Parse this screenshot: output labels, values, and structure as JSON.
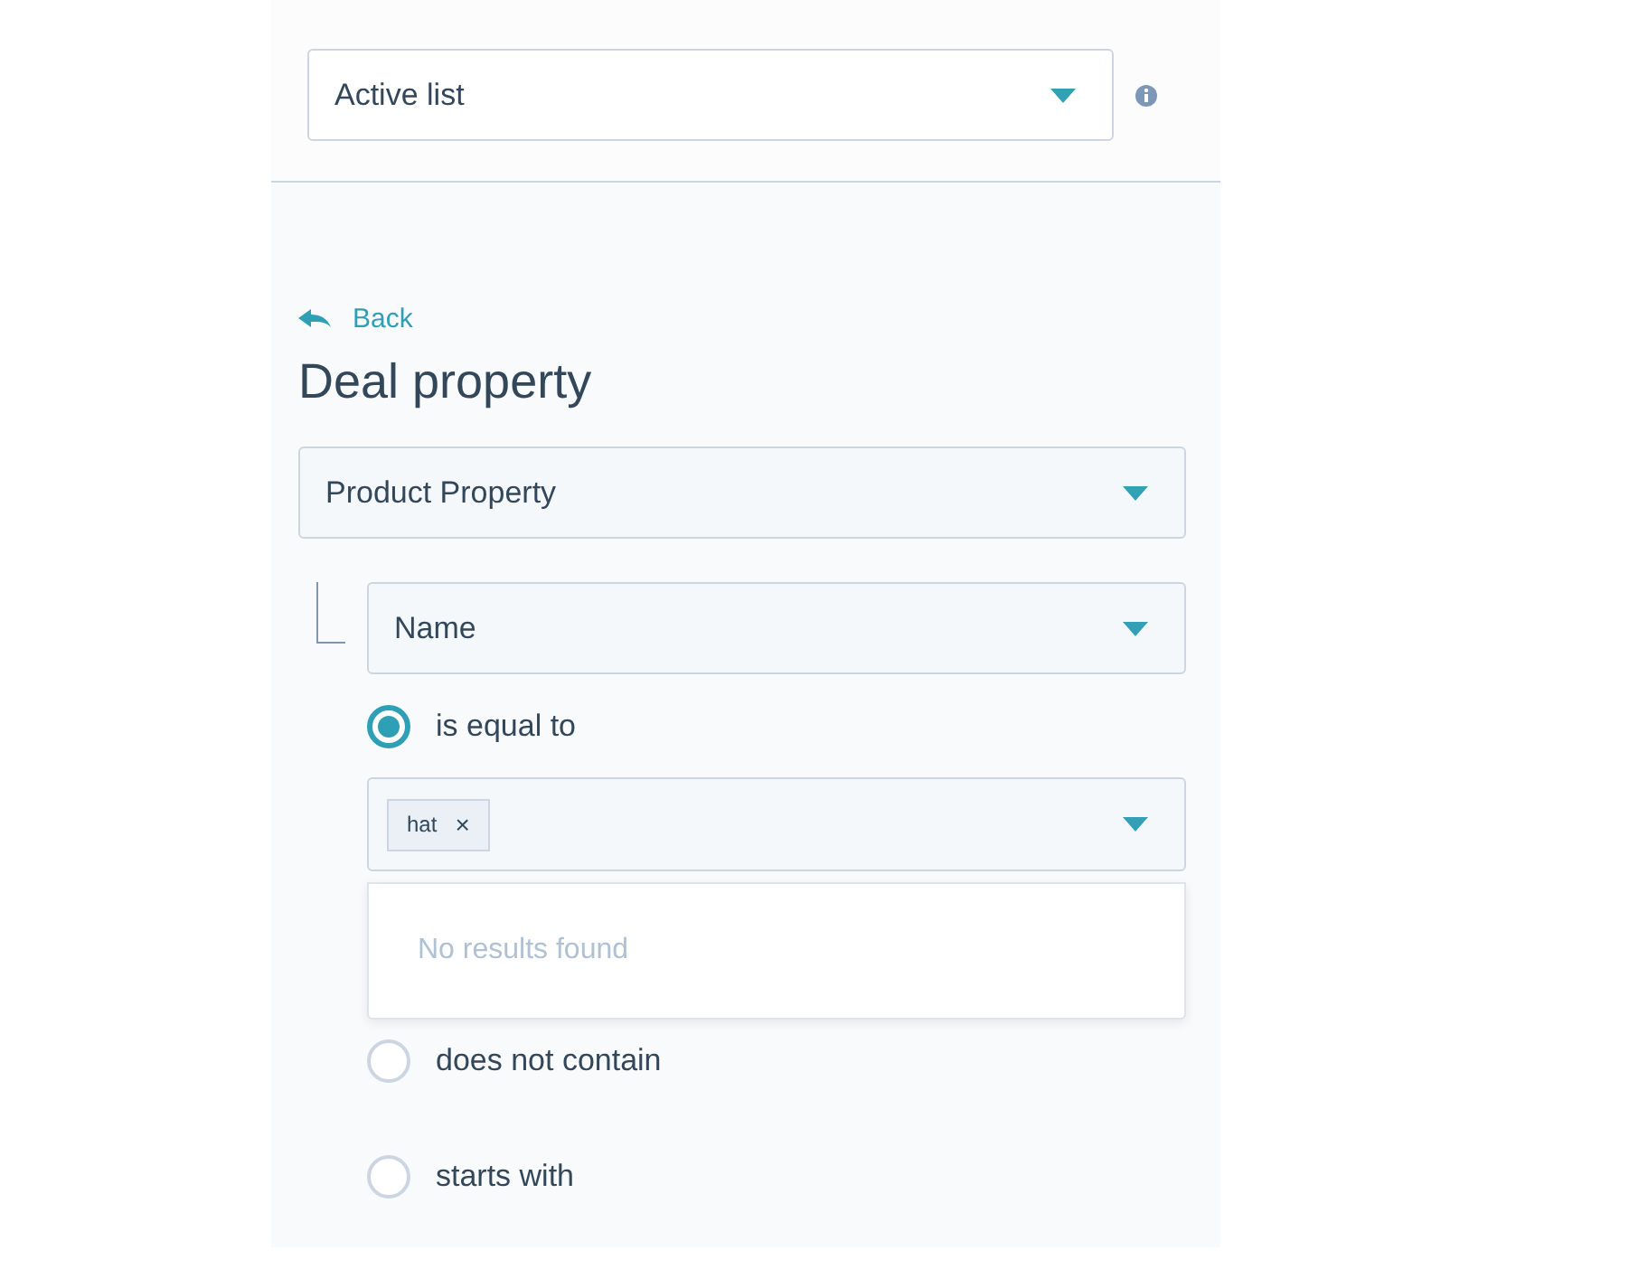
{
  "list_type": {
    "value": "Active list"
  },
  "back": {
    "label": "Back"
  },
  "title": "Deal property",
  "property": {
    "value": "Product Property"
  },
  "sub_property": {
    "value": "Name"
  },
  "operators": [
    {
      "label": "is equal to",
      "selected": true,
      "tags": [
        "hat"
      ],
      "tag_remove": "×",
      "popup": "No results found"
    },
    {
      "label": "does not contain",
      "selected": false
    },
    {
      "label": "starts with",
      "selected": false
    }
  ]
}
